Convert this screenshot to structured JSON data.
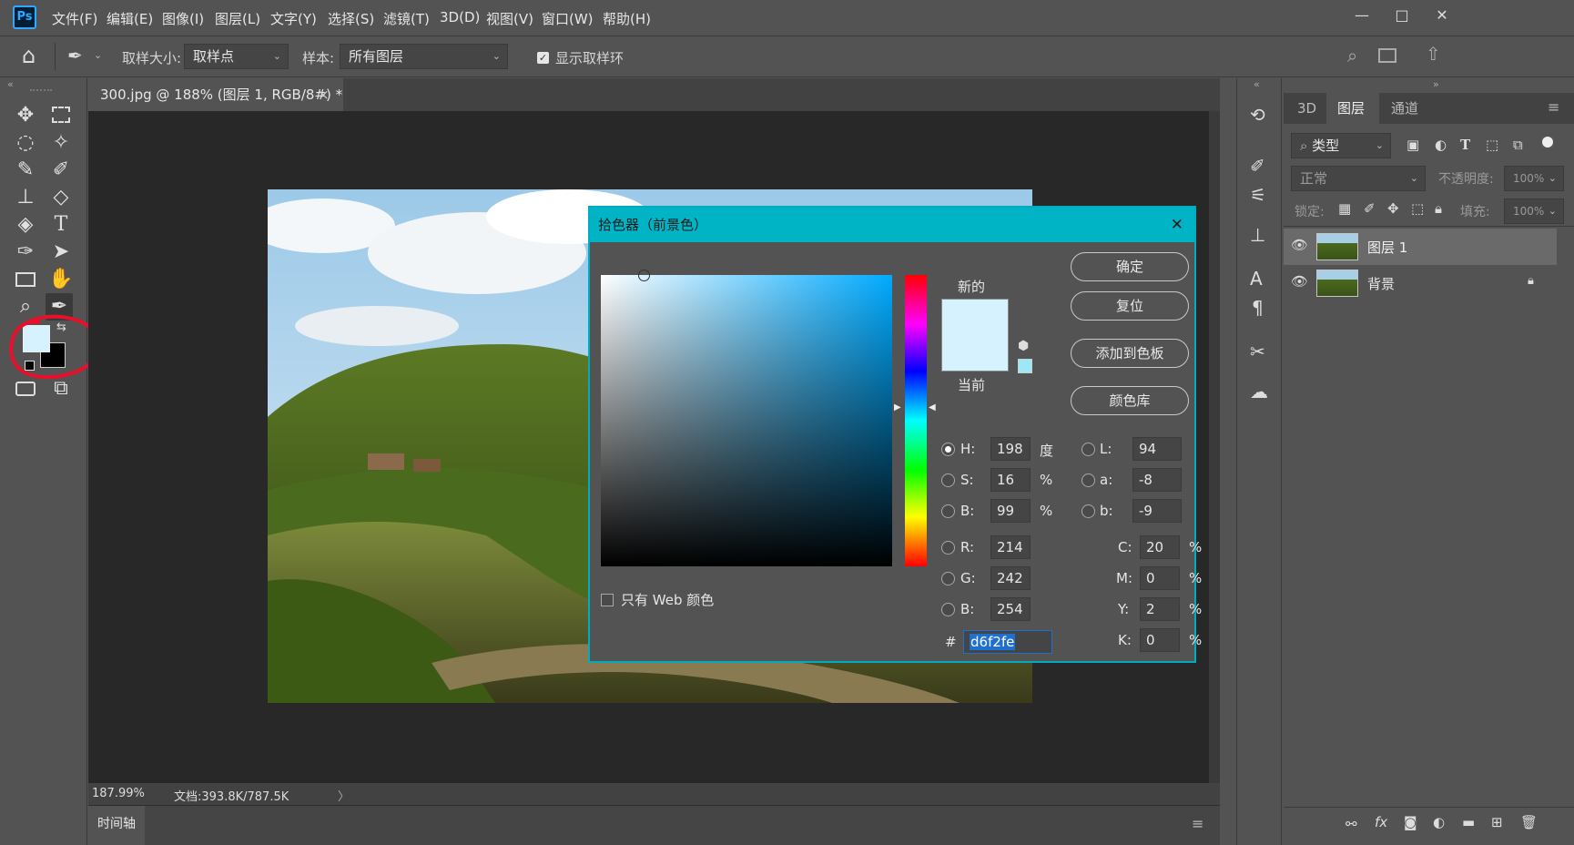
{
  "app": {
    "logo": "Ps"
  },
  "menu": [
    "文件(F)",
    "编辑(E)",
    "图像(I)",
    "图层(L)",
    "文字(Y)",
    "选择(S)",
    "滤镜(T)",
    "3D(D)",
    "视图(V)",
    "窗口(W)",
    "帮助(H)"
  ],
  "window": {
    "minimize": "—",
    "restore": "□",
    "close": "✕"
  },
  "options": {
    "sample_size_label": "取样大小:",
    "sample_size_value": "取样点",
    "sample_label": "样本:",
    "sample_value": "所有图层",
    "show_ring_label": "显示取样环"
  },
  "document": {
    "tab_title": "300.jpg @ 188% (图层 1, RGB/8#) *",
    "tab_close": "×",
    "zoom": "187.99%",
    "doc_info": "文档:393.8K/787.5K",
    "status_arrow": "〉",
    "timeline": "时间轴"
  },
  "dialog": {
    "title": "拾色器（前景色）",
    "close": "✕",
    "new_label": "新的",
    "current_label": "当前",
    "buttons": {
      "ok": "确定",
      "reset": "复位",
      "add_swatch": "添加到色板",
      "libraries": "颜色库"
    },
    "web_only": "只有 Web 颜色",
    "hsb": {
      "h_label": "H:",
      "h": "198",
      "h_unit": "度",
      "s_label": "S:",
      "s": "16",
      "s_unit": "%",
      "b_label": "B:",
      "b": "99",
      "b_unit": "%"
    },
    "lab": {
      "l_label": "L:",
      "l": "94",
      "a_label": "a:",
      "a": "-8",
      "b_label": "b:",
      "b": "-9"
    },
    "rgb": {
      "r_label": "R:",
      "r": "214",
      "g_label": "G:",
      "g": "242",
      "b_label": "B:",
      "b": "254"
    },
    "cmyk": {
      "c_label": "C:",
      "c": "20",
      "m_label": "M:",
      "m": "0",
      "y_label": "Y:",
      "y": "2",
      "k_label": "K:",
      "k": "0",
      "unit": "%"
    },
    "hex_label": "#",
    "hex": "d6f2fe",
    "new_color": "#d6f2fe",
    "current_color": "#d6f2fe"
  },
  "colors": {
    "foreground": "#d6f2fe",
    "background": "#000000",
    "accent": "#00b4c5",
    "annotation": "#e8102b"
  },
  "layers_panel": {
    "tabs": [
      "3D",
      "图层",
      "通道"
    ],
    "active_tab": "图层",
    "filter_label": "类型",
    "blend_mode": "正常",
    "opacity_label": "不透明度:",
    "opacity": "100%",
    "lock_label": "锁定:",
    "fill_label": "填充:",
    "fill": "100%",
    "layers": [
      {
        "name": "图层 1",
        "selected": true,
        "locked": false
      },
      {
        "name": "背景",
        "selected": false,
        "locked": true
      }
    ]
  }
}
